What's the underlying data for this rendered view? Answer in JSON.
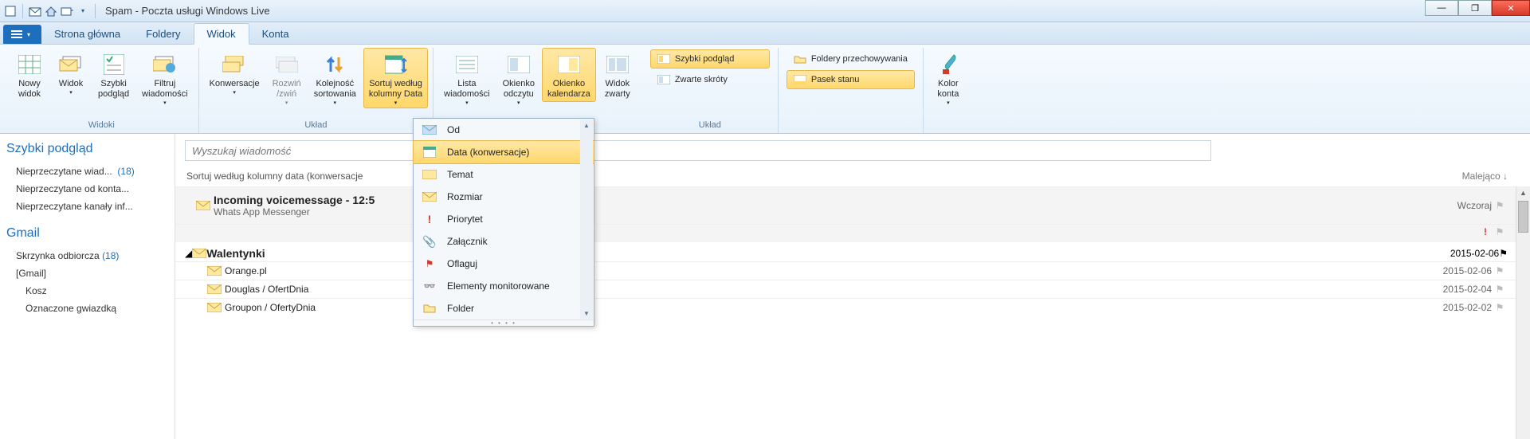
{
  "window": {
    "title": "Spam - Poczta usługi Windows Live"
  },
  "tabs": {
    "file_caret": "▾",
    "items": [
      "Strona główna",
      "Foldery",
      "Widok",
      "Konta"
    ],
    "active": 2
  },
  "ribbon": {
    "groups": [
      {
        "label": "Widoki",
        "big": [
          {
            "label": "Nowy\nwidok",
            "icon": "grid"
          },
          {
            "label": "Widok",
            "icon": "envelopes",
            "caret": true
          },
          {
            "label": "Szybki\npodgląd",
            "icon": "checklist"
          },
          {
            "label": "Filtruj\nwiadomości",
            "icon": "filter-mail",
            "caret": true
          }
        ]
      },
      {
        "label": "Układ",
        "big": [
          {
            "label": "Konwersacje",
            "icon": "conv",
            "caret": true
          },
          {
            "label": "Rozwiń\n/zwiń",
            "icon": "expand",
            "caret": true,
            "dim": true
          },
          {
            "label": "Kolejność\nsortowania",
            "icon": "sort-arrows",
            "caret": true
          },
          {
            "label": "Sortuj według\nkolumny Data",
            "icon": "calendar-sort",
            "caret": true,
            "active": true
          }
        ]
      },
      {
        "label": "",
        "big": [
          {
            "label": "Lista\nwiadomości",
            "icon": "list-pane",
            "caret": true
          },
          {
            "label": "Okienko\nodczytu",
            "icon": "read-pane",
            "caret": true
          },
          {
            "label": "Okienko\nkalendarza",
            "icon": "cal-pane",
            "active": true
          },
          {
            "label": "Widok\nzwarty",
            "icon": "compact"
          }
        ]
      },
      {
        "label": "Układ",
        "small": [
          {
            "label": "Szybki podgląd",
            "icon": "pane-orange",
            "active": true
          },
          {
            "label": "Zwarte skróty",
            "icon": "pane-blue"
          }
        ]
      },
      {
        "label": "",
        "small": [
          {
            "label": "Foldery przechowywania",
            "icon": "folder-small"
          },
          {
            "label": "Pasek stanu",
            "icon": "status-bar",
            "active": true
          }
        ]
      },
      {
        "label": "",
        "big": [
          {
            "label": "Kolor\nkonta",
            "icon": "brush",
            "caret": true
          }
        ]
      }
    ]
  },
  "dropdown": {
    "items": [
      {
        "label": "Od",
        "icon": "mail-from"
      },
      {
        "label": "Data (konwersacje)",
        "icon": "calendar",
        "active": true
      },
      {
        "label": "Temat",
        "icon": "mail-subject"
      },
      {
        "label": "Rozmiar",
        "icon": "mail-size"
      },
      {
        "label": "Priorytet",
        "icon": "priority"
      },
      {
        "label": "Załącznik",
        "icon": "attachment"
      },
      {
        "label": "Oflaguj",
        "icon": "flag"
      },
      {
        "label": "Elementy monitorowane",
        "icon": "watch"
      },
      {
        "label": "Folder",
        "icon": "folder"
      }
    ]
  },
  "sidebar": {
    "heading1": "Szybki podgląd",
    "quick": [
      {
        "label": "Nieprzeczytane wiad...",
        "count": "(18)"
      },
      {
        "label": "Nieprzeczytane od konta..."
      },
      {
        "label": "Nieprzeczytane kanały inf..."
      }
    ],
    "heading2": "Gmail",
    "folders": [
      {
        "label": "Skrzynka odbiorcza",
        "count": "(18)"
      },
      {
        "label": "[Gmail]"
      },
      {
        "label": "Kosz",
        "indent": true
      },
      {
        "label": "Oznaczone gwiazdką",
        "indent": true
      }
    ]
  },
  "search": {
    "placeholder": "Wyszukaj wiadomość"
  },
  "sortline": {
    "left": "Sortuj według kolumny data (konwersacje",
    "right": "Malejąco ↓"
  },
  "messages": {
    "group1": {
      "selected": {
        "subject": "Incoming voicemessage - 12:5",
        "sender": "Whats App Messenger",
        "date": "Wczoraj",
        "priority": true
      }
    },
    "group2": {
      "header": "Walentynki",
      "rows": [
        {
          "sender": "Orange.pl",
          "date": "2015-02-06"
        },
        {
          "sender": "Douglas / OfertDnia",
          "date": "2015-02-04"
        },
        {
          "sender": "Groupon / OfertyDnia",
          "date": "2015-02-02"
        }
      ],
      "extra_date": "2015-02-06"
    }
  }
}
